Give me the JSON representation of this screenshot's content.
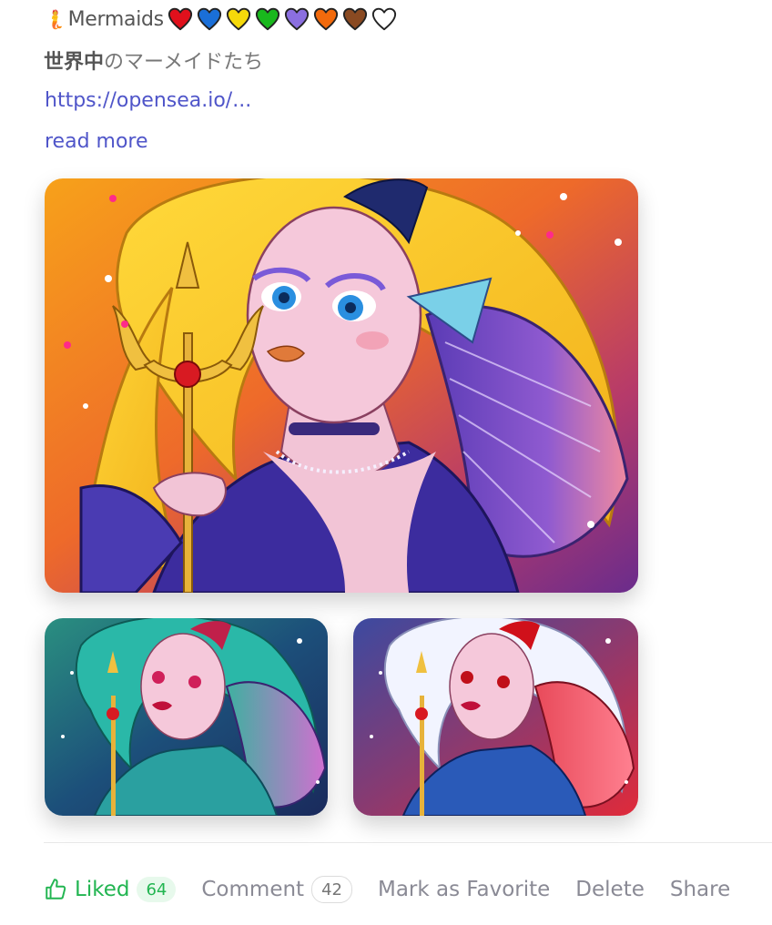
{
  "post": {
    "title_emoji": "🧜",
    "title": "Mermaids",
    "hearts": [
      {
        "name": "red-heart-icon",
        "color": "#e0101c"
      },
      {
        "name": "blue-heart-icon",
        "color": "#1a6fd8"
      },
      {
        "name": "yellow-heart-icon",
        "color": "#f5d90a"
      },
      {
        "name": "green-heart-icon",
        "color": "#19b81d"
      },
      {
        "name": "purple-heart-icon",
        "color": "#8b6fe0"
      },
      {
        "name": "orange-heart-icon",
        "color": "#f26a0c"
      },
      {
        "name": "brown-heart-icon",
        "color": "#8a4a22"
      },
      {
        "name": "white-heart-icon",
        "color": "#ffffff"
      }
    ],
    "subtitle_bold": "世界中",
    "subtitle_rest": "のマーメイドたち",
    "link": "https://opensea.io/...",
    "read_more": "read more"
  },
  "images": {
    "main": {
      "alt": "Golden-haired mermaid queen with trident",
      "bg": "#f0811c"
    },
    "thumb1": {
      "alt": "Teal-haired mermaid queen with trident",
      "bg": "#1f7f74"
    },
    "thumb2": {
      "alt": "White-haired mermaid queen with trident",
      "bg": "#c73a4a"
    }
  },
  "actions": {
    "liked_label": "Liked",
    "liked_count": "64",
    "comment_label": "Comment",
    "comment_count": "42",
    "favorite_label": "Mark as Favorite",
    "delete_label": "Delete",
    "share_label": "Share"
  },
  "colors": {
    "link": "#4f55c9",
    "liked": "#22b551"
  }
}
